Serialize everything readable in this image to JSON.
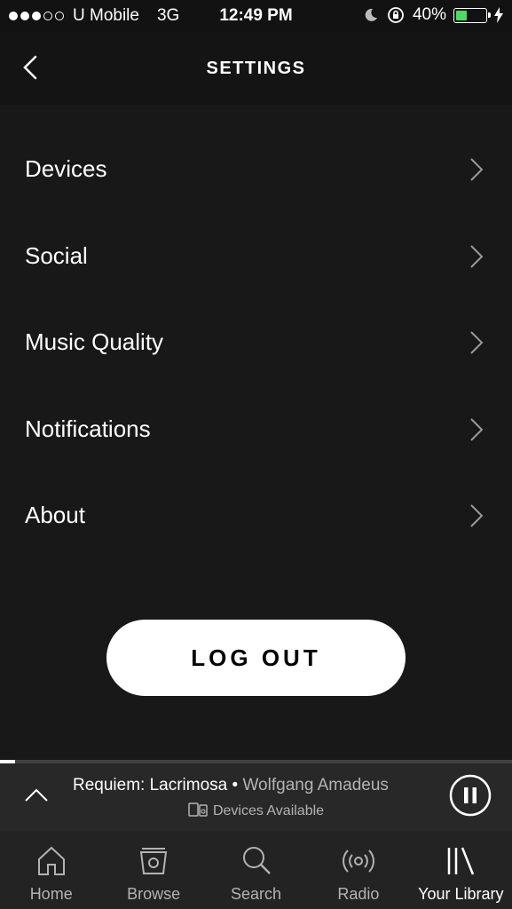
{
  "status_bar": {
    "carrier": "U Mobile",
    "network": "3G",
    "time": "12:49 PM",
    "battery": "40%",
    "battery_level": 0.4,
    "signal_bars_filled": 3,
    "signal_bars_total": 5
  },
  "header": {
    "title": "SETTINGS"
  },
  "settings": {
    "items": [
      {
        "label": "Devices"
      },
      {
        "label": "Social"
      },
      {
        "label": "Music Quality"
      },
      {
        "label": "Notifications"
      },
      {
        "label": "About"
      }
    ]
  },
  "logout_label": "LOG OUT",
  "now_playing": {
    "track": "Requiem: Lacrimosa",
    "separator": " • ",
    "artist": "Wolfgang Amadeus",
    "devices": "Devices Available",
    "progress": 0.03
  },
  "tabs": [
    {
      "label": "Home",
      "icon": "home-icon"
    },
    {
      "label": "Browse",
      "icon": "browse-icon"
    },
    {
      "label": "Search",
      "icon": "search-icon"
    },
    {
      "label": "Radio",
      "icon": "radio-icon"
    },
    {
      "label": "Your Library",
      "icon": "library-icon"
    }
  ],
  "colors": {
    "background": "#181818",
    "accent_battery": "#4cd964",
    "button_bg": "#ffffff"
  }
}
